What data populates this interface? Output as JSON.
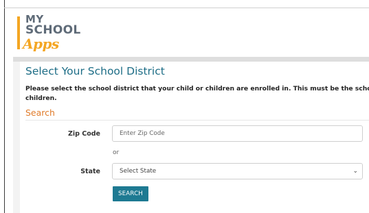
{
  "logo": {
    "line1": "MY",
    "line2": "SCHOOL",
    "line3": "Apps"
  },
  "page": {
    "title": "Select Your School District",
    "intro_line1": "Please select the school district that your child or children are enrolled in. This must be the school district in w",
    "intro_line2": "children."
  },
  "search": {
    "section_title": "Search",
    "zip_label": "Zip Code",
    "zip_placeholder": "Enter Zip Code",
    "zip_value": "",
    "or_text": "or",
    "state_label": "State",
    "state_selected": "Select State",
    "button_label": "SEARCH"
  },
  "colors": {
    "title": "#1d6d86",
    "section_title": "#e07b2a",
    "button": "#1e7a92",
    "logo_accent": "#f4a623",
    "logo_text": "#5f6b78"
  },
  "icons": {
    "dropdown": "chevron-down-icon"
  }
}
